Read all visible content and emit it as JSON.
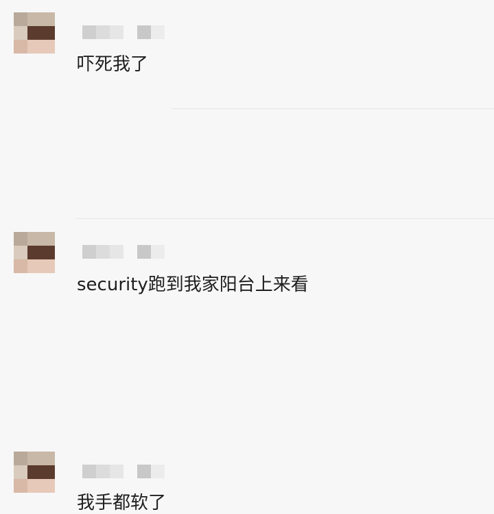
{
  "comments": [
    {
      "text": "吓死我了",
      "avatar_colors": [
        "#b9a99a",
        "#c8b8a7",
        "#d9cbbd",
        "#5b3b2e",
        "#d8b8a6",
        "#e6c9b8"
      ]
    },
    {
      "text": "security跑到我家阳台上来看",
      "avatar_colors": [
        "#b9a99a",
        "#c8b8a7",
        "#d9cbbd",
        "#5b3b2e",
        "#d8b8a6",
        "#e6c9b8"
      ]
    },
    {
      "text": "我手都软了",
      "avatar_colors": [
        "#b9a99a",
        "#c8b8a7",
        "#d9cbbd",
        "#5b3b2e",
        "#d8b8a6",
        "#e6c9b8"
      ]
    }
  ]
}
